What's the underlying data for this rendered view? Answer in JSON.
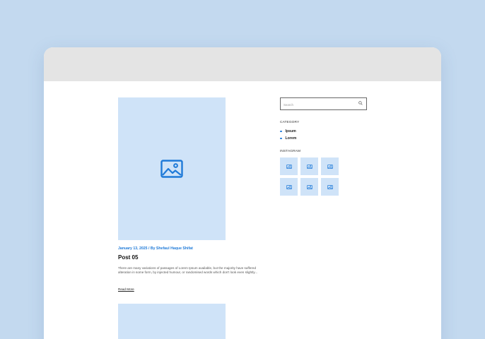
{
  "post": {
    "meta": "January 13, 2025 / By Shefaul Haque Shifat",
    "title": "Post 05",
    "excerpt": "There are many variations of passages of Lorem Ipsum available, but the majority have suffered alteration in some form, by injected humour, or randomised words which don't look even slightly...",
    "read_more": "Read More",
    "image_icon": "image-icon"
  },
  "sidebar": {
    "search": {
      "placeholder": "Search",
      "icon": "search-icon"
    },
    "category": {
      "heading": "CATEGORY",
      "items": [
        {
          "label": "Ipsum"
        },
        {
          "label": "Lorem"
        }
      ]
    },
    "instagram": {
      "heading": "INSTAGRAM",
      "tile_icon": "image-icon",
      "tile_count": 6
    }
  },
  "colors": {
    "background": "#c3d9ef",
    "titlebar": "#e4e4e4",
    "placeholder_fill": "#cfe3f8",
    "accent": "#1f7ad8"
  }
}
